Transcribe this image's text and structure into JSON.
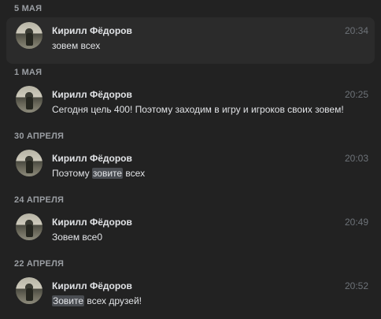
{
  "messages": [
    {
      "date": "5 МАЯ",
      "author": "Кирилл Фёдоров",
      "time": "20:34",
      "text_before": "зовем всех",
      "text_mark": "",
      "text_after": ""
    },
    {
      "date": "1 МАЯ",
      "author": "Кирилл Фёдоров",
      "time": "20:25",
      "text_before": "Сегодня цель 400! Поэтому заходим в игру и игроков своих зовем!",
      "text_mark": "",
      "text_after": ""
    },
    {
      "date": "30 АПРЕЛЯ",
      "author": "Кирилл Фёдоров",
      "time": "20:03",
      "text_before": "Поэтому ",
      "text_mark": "зовите",
      "text_after": " всех"
    },
    {
      "date": "24 АПРЕЛЯ",
      "author": "Кирилл Фёдоров",
      "time": "20:49",
      "text_before": "Зовем все0",
      "text_mark": "",
      "text_after": ""
    },
    {
      "date": "22 АПРЕЛЯ",
      "author": "Кирилл Фёдоров",
      "time": "20:52",
      "text_before": "",
      "text_mark": "Зовите",
      "text_after": " всех друзей!"
    }
  ]
}
